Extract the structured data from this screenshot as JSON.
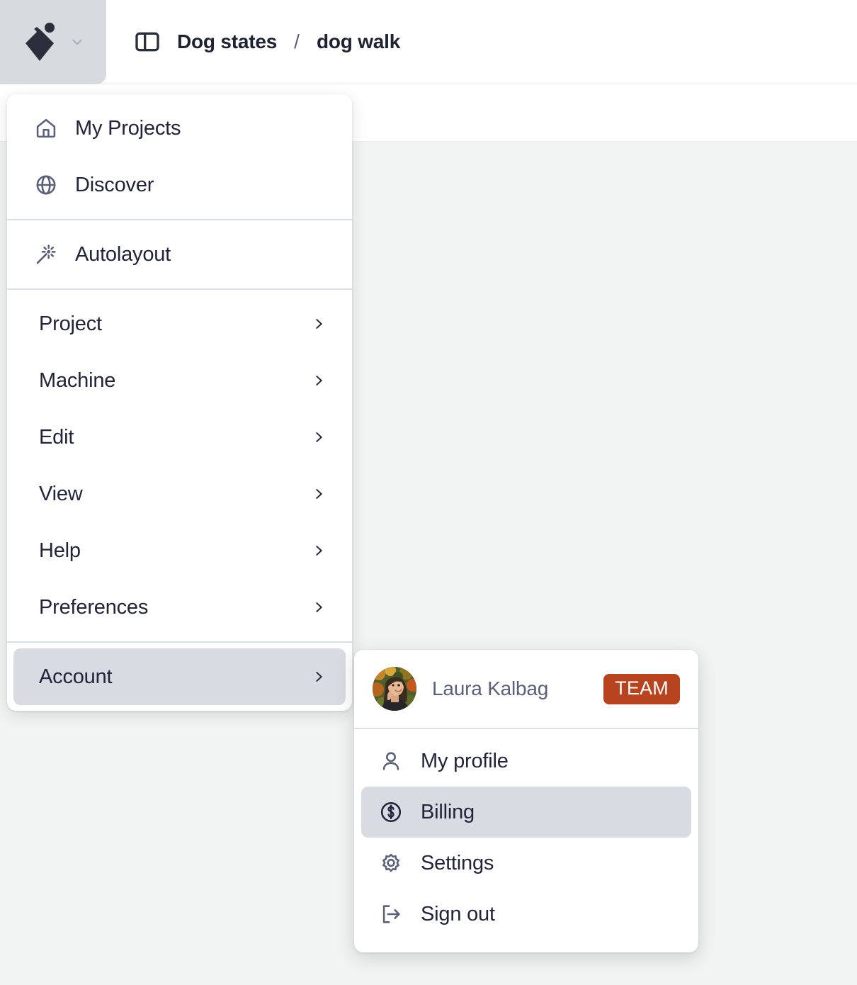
{
  "header": {
    "logo_name": "stately-logo",
    "logo_dropdown_icon": "chevron-down-icon",
    "panel_toggle_icon": "panel-left-icon",
    "breadcrumb": {
      "project": "Dog states",
      "separator": "/",
      "machine": "dog walk"
    }
  },
  "menu": {
    "sections": [
      {
        "items": [
          {
            "label": "My Projects",
            "icon": "home-icon",
            "has_submenu": false,
            "highlighted": false
          },
          {
            "label": "Discover",
            "icon": "globe-icon",
            "has_submenu": false,
            "highlighted": false
          }
        ]
      },
      {
        "items": [
          {
            "label": "Autolayout",
            "icon": "magic-wand-icon",
            "has_submenu": false,
            "highlighted": false
          }
        ]
      },
      {
        "items": [
          {
            "label": "Project",
            "icon": null,
            "has_submenu": true,
            "highlighted": false
          },
          {
            "label": "Machine",
            "icon": null,
            "has_submenu": true,
            "highlighted": false
          },
          {
            "label": "Edit",
            "icon": null,
            "has_submenu": true,
            "highlighted": false
          },
          {
            "label": "View",
            "icon": null,
            "has_submenu": true,
            "highlighted": false
          },
          {
            "label": "Help",
            "icon": null,
            "has_submenu": true,
            "highlighted": false
          },
          {
            "label": "Preferences",
            "icon": null,
            "has_submenu": true,
            "highlighted": false
          }
        ]
      },
      {
        "items": [
          {
            "label": "Account",
            "icon": null,
            "has_submenu": true,
            "highlighted": true
          }
        ]
      }
    ]
  },
  "account_submenu": {
    "user": {
      "name": "Laura Kalbag",
      "avatar_name": "user-avatar",
      "plan_badge": "TEAM"
    },
    "items": [
      {
        "label": "My profile",
        "icon": "person-icon",
        "highlighted": false
      },
      {
        "label": "Billing",
        "icon": "dollar-circle-icon",
        "highlighted": true
      },
      {
        "label": "Settings",
        "icon": "gear-icon",
        "highlighted": false
      },
      {
        "label": "Sign out",
        "icon": "sign-out-icon",
        "highlighted": false
      }
    ]
  },
  "colors": {
    "badge_team": "#b8441f",
    "highlight": "#d8dbe2",
    "logo_button_bg": "#d7dade",
    "canvas": "#f2f4f3",
    "text_primary": "#22253a",
    "text_muted": "#5b6079"
  }
}
